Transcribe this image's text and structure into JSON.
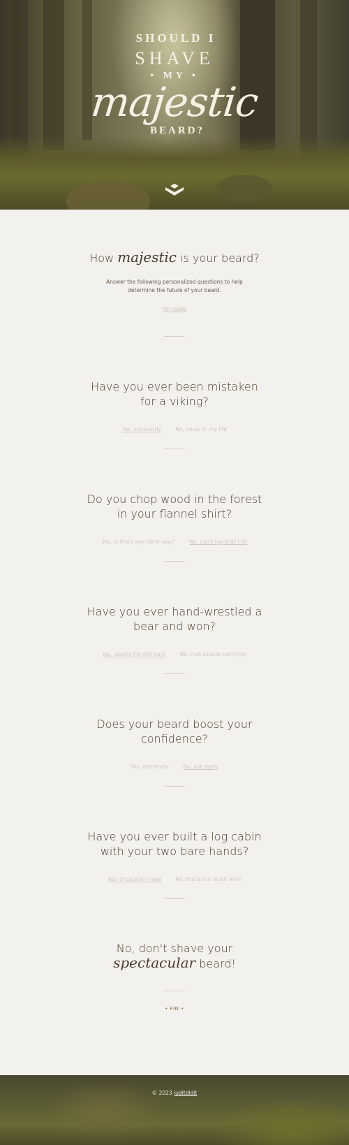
{
  "hero": {
    "line1": "SHOULD I",
    "line2": "SHAVE",
    "line3": "• MY •",
    "line4": "majestic",
    "line5": "BEARD?",
    "scroll_icon": "chevron-down-icon"
  },
  "intro": {
    "title_pre": "How",
    "title_script": "majestic",
    "title_post": "is your beard?",
    "description": "Answer the following personalized questions to help determine the future of your beard.",
    "start_link": "I'm ready"
  },
  "questions": [
    {
      "title": "Have you ever been mistaken for a viking?",
      "yes": "Yes, constantly",
      "no": "No, never in my life"
    },
    {
      "title": "Do you chop wood in the forest in your flannel shirt?",
      "yes": "Yes, is there any other way?",
      "no": "No, can't say that I do"
    },
    {
      "title": "Have you ever hand-wrestled a bear and won?",
      "yes": "Yes, clearly I'm still here",
      "no": "No, that sounds terrifying"
    },
    {
      "title": "Does your beard boost your confidence?",
      "yes": "Yes, extremely",
      "no": "No, not really"
    },
    {
      "title": "Have you ever built a log cabin with your two bare hands?",
      "yes": "Yes, of course I have",
      "no": "No, that's too much work"
    }
  ],
  "result": {
    "line1": "No, don't shave your",
    "script": "spectacular",
    "line2_post": "beard!",
    "fin": "• FIN •"
  },
  "footer": {
    "copyright": "© 2023",
    "author_link": "juditdidit"
  },
  "colors": {
    "background": "#f3f1ed",
    "heading": "#4a3a2c",
    "link_faded": "#d0c8bd",
    "accent": "#8a6d48"
  }
}
